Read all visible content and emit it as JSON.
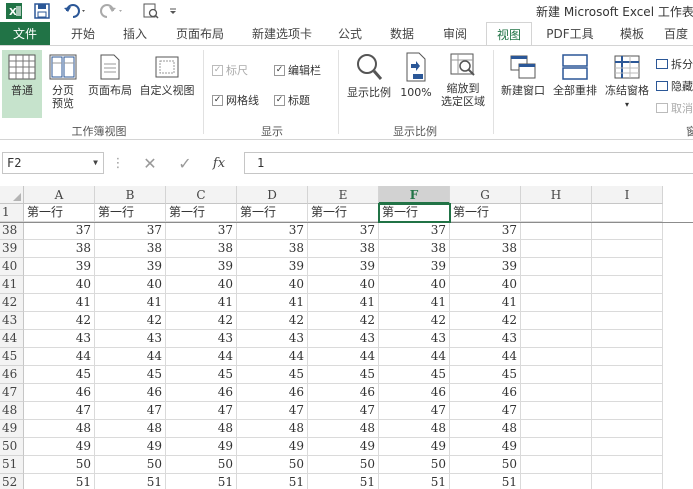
{
  "titlebar": {
    "title": "新建 Microsoft Excel 工作表",
    "icons": [
      "excel-logo-icon",
      "save-icon",
      "undo-icon",
      "redo-icon",
      "print-preview-icon",
      "customize-qat-icon"
    ]
  },
  "tabs": [
    {
      "label": "文件"
    },
    {
      "label": "开始"
    },
    {
      "label": "插入"
    },
    {
      "label": "页面布局"
    },
    {
      "label": "新建选项卡"
    },
    {
      "label": "公式"
    },
    {
      "label": "数据"
    },
    {
      "label": "审阅"
    },
    {
      "label": "视图"
    },
    {
      "label": "PDF工具"
    },
    {
      "label": "模板"
    },
    {
      "label": "百度"
    }
  ],
  "ribbon": {
    "workbook_views": {
      "normal": "普通",
      "page_break_line1": "分页",
      "page_break_line2": "预览",
      "page_layout": "页面布局",
      "custom_view": "自定义视图",
      "group_label": "工作簿视图"
    },
    "show": {
      "ruler": "标尺",
      "formula_bar": "编辑栏",
      "gridlines": "网格线",
      "headings": "标题",
      "group_label": "显示"
    },
    "zoom": {
      "zoom": "显示比例",
      "zoom100": "100%",
      "zoom_selection_line1": "缩放到",
      "zoom_selection_line2": "选定区域",
      "group_label": "显示比例"
    },
    "window": {
      "new_window": "新建窗口",
      "arrange_all": "全部重排",
      "freeze_panes": "冻结窗格",
      "split": "拆分",
      "hide": "隐藏",
      "unhide": "取消",
      "group_label_partial": "窗"
    }
  },
  "formula_bar": {
    "name_box": "F2",
    "fx_label": "fx",
    "value": "1"
  },
  "grid": {
    "columns": [
      "A",
      "B",
      "C",
      "D",
      "E",
      "F",
      "G",
      "H",
      "I"
    ],
    "selected_column": "F",
    "header_row": {
      "row": "1",
      "cells": [
        "第一行",
        "第一行",
        "第一行",
        "第一行",
        "第一行",
        "第一行",
        "第一行",
        "",
        ""
      ]
    },
    "rows": [
      {
        "row": "38",
        "cells": [
          "37",
          "37",
          "37",
          "37",
          "37",
          "37",
          "37",
          "",
          ""
        ]
      },
      {
        "row": "39",
        "cells": [
          "38",
          "38",
          "38",
          "38",
          "38",
          "38",
          "38",
          "",
          ""
        ]
      },
      {
        "row": "40",
        "cells": [
          "39",
          "39",
          "39",
          "39",
          "39",
          "39",
          "39",
          "",
          ""
        ]
      },
      {
        "row": "41",
        "cells": [
          "40",
          "40",
          "40",
          "40",
          "40",
          "40",
          "40",
          "",
          ""
        ]
      },
      {
        "row": "42",
        "cells": [
          "41",
          "41",
          "41",
          "41",
          "41",
          "41",
          "41",
          "",
          ""
        ]
      },
      {
        "row": "43",
        "cells": [
          "42",
          "42",
          "42",
          "42",
          "42",
          "42",
          "42",
          "",
          ""
        ]
      },
      {
        "row": "44",
        "cells": [
          "43",
          "43",
          "43",
          "43",
          "43",
          "43",
          "43",
          "",
          ""
        ]
      },
      {
        "row": "45",
        "cells": [
          "44",
          "44",
          "44",
          "44",
          "44",
          "44",
          "44",
          "",
          ""
        ]
      },
      {
        "row": "46",
        "cells": [
          "45",
          "45",
          "45",
          "45",
          "45",
          "45",
          "45",
          "",
          ""
        ]
      },
      {
        "row": "47",
        "cells": [
          "46",
          "46",
          "46",
          "46",
          "46",
          "46",
          "46",
          "",
          ""
        ]
      },
      {
        "row": "48",
        "cells": [
          "47",
          "47",
          "47",
          "47",
          "47",
          "47",
          "47",
          "",
          ""
        ]
      },
      {
        "row": "49",
        "cells": [
          "48",
          "48",
          "48",
          "48",
          "48",
          "48",
          "48",
          "",
          ""
        ]
      },
      {
        "row": "50",
        "cells": [
          "49",
          "49",
          "49",
          "49",
          "49",
          "49",
          "49",
          "",
          ""
        ]
      },
      {
        "row": "51",
        "cells": [
          "50",
          "50",
          "50",
          "50",
          "50",
          "50",
          "50",
          "",
          ""
        ]
      },
      {
        "row": "52",
        "cells": [
          "51",
          "51",
          "51",
          "51",
          "51",
          "51",
          "51",
          "",
          ""
        ]
      }
    ]
  },
  "colors": {
    "accent": "#217346",
    "selected_button_bg": "#c6e3cc"
  }
}
